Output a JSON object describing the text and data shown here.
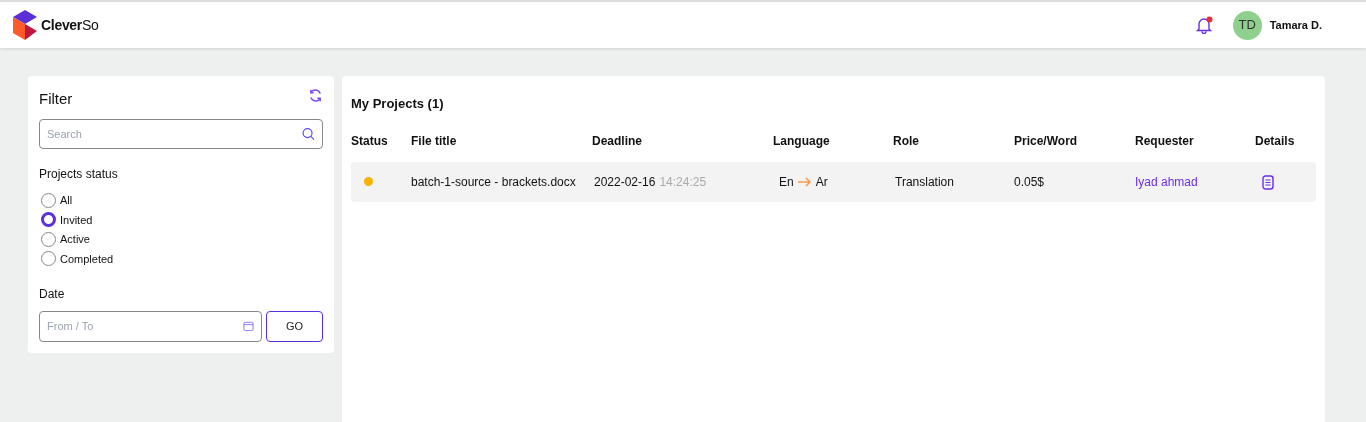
{
  "header": {
    "brand": {
      "first": "Clever",
      "second": "So"
    },
    "notifications": {
      "unread": true
    },
    "user": {
      "initials": "TD",
      "name": "Tamara D."
    }
  },
  "filter": {
    "title": "Filter",
    "search": {
      "placeholder": "Search"
    },
    "status_label": "Projects status",
    "statuses": [
      {
        "label": "All",
        "selected": false
      },
      {
        "label": "Invited",
        "selected": true
      },
      {
        "label": "Active",
        "selected": false
      },
      {
        "label": "Completed",
        "selected": false
      }
    ],
    "date_label": "Date",
    "date": {
      "placeholder": "From / To"
    },
    "go_button": "GO"
  },
  "projects": {
    "title": "My Projects (1)",
    "columns": [
      "Status",
      "File title",
      "Deadline",
      "Language",
      "Role",
      "Price/Word",
      "Requester",
      "Details"
    ],
    "rows": [
      {
        "color": "#f5b400",
        "file_title": "batch-1-source - brackets.docx",
        "deadline_date": "2022-02-16",
        "deadline_time": "14:24:25",
        "language_from": "En",
        "language_to": "Ar",
        "role": "Translation",
        "price": "0.05$",
        "requester": "Iyad ahmad"
      }
    ]
  }
}
